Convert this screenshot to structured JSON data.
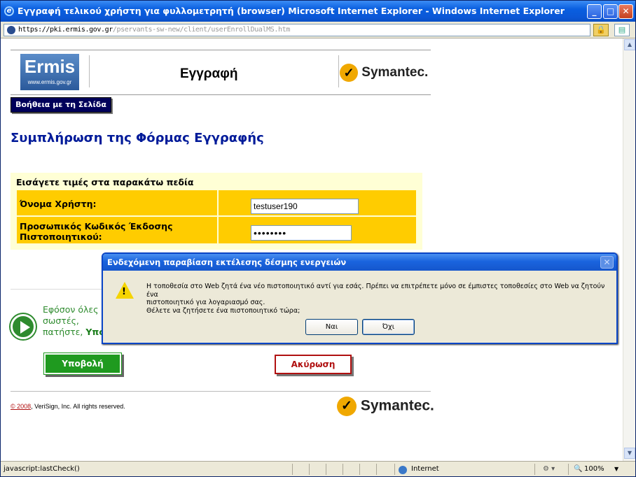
{
  "window": {
    "title": "Εγγραφή τελικού χρήστη για φυλλομετρητή (browser) Microsoft Internet Explorer - Windows Internet Explorer",
    "address_https": "https://",
    "address_host": "pki.ermis.gov.gr",
    "address_path": "/pservants-sw-new/client/userEnrollDualMS.htm"
  },
  "header": {
    "logo_text": "Ermis",
    "logo_url": "www.ermis.gov.gr",
    "title": "Εγγραφή",
    "partner_logo": "Symantec."
  },
  "help_button": "Βοήθεια με τη Σελίδα",
  "section_title": "Συμπλήρωση της Φόρμας Εγγραφής",
  "form": {
    "caption": "Εισάγετε τιμές στα παρακάτω πεδία",
    "username_label": "Όνομα Χρήστη:",
    "username_value": "testuser190",
    "pin_label_line1": "Προσωπικός Κωδικός Έκδοσης",
    "pin_label_line2": "Πιστοποιητικού:",
    "pin_value": "••••••••"
  },
  "instructions": {
    "line1": "Εφόσον όλες",
    "line2": "σωστές,",
    "line3_prefix": "πατήστε, ",
    "line3_bold": "Υπο"
  },
  "buttons": {
    "submit": "Υποβολή",
    "cancel": "Ακύρωση"
  },
  "footer": {
    "year": "© 2008",
    "rights": ", VeriSign, Inc. All rights reserved.",
    "logo": "Symantec."
  },
  "dialog": {
    "title": "Ενδεχόμενη παραβίαση εκτέλεσης δέσμης ενεργειών",
    "message_line1": "Η τοποθεσία στο Web ζητά ένα νέο πιστοποιητικό αντί για εσάς. Πρέπει να επιτρέπετε μόνο σε έμπιστες τοποθεσίες στο Web να ζητούν ένα",
    "message_line2": "πιστοποιητικό για λογαριασμό σας.",
    "message_line3": "Θέλετε να  ζητήσετε ένα πιστοποιητικό τώρα;",
    "yes": "Ναι",
    "no": "Όχι"
  },
  "statusbar": {
    "text": "javascript:lastCheck()",
    "zone": "Internet",
    "zoom": "100%"
  }
}
